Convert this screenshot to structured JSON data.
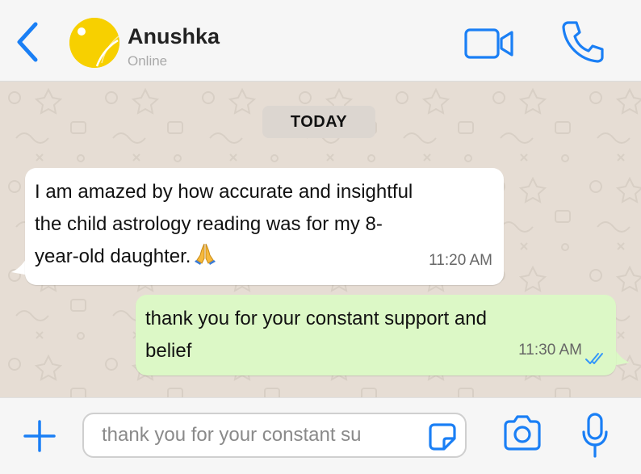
{
  "header": {
    "back_icon": "chevron-left-icon",
    "contact_name": "Anushka",
    "contact_status": "Online",
    "video_icon": "video-camera-icon",
    "call_icon": "phone-icon"
  },
  "chat": {
    "date_separator": "TODAY",
    "messages": [
      {
        "direction": "incoming",
        "lines": [
          "I am amazed by how accurate and insightful",
          "the child astrology reading was for my 8-",
          "year-old daughter."
        ],
        "emoji": "folded-hands-icon",
        "time": "11:20 AM"
      },
      {
        "direction": "outgoing",
        "lines": [
          "thank you for your constant support and",
          "belief"
        ],
        "time": "11:30 AM",
        "status_icon": "double-check-icon"
      }
    ]
  },
  "composer": {
    "plus_icon": "plus-icon",
    "input_value": "thank you for your constant su",
    "sticker_icon": "sticker-icon",
    "camera_icon": "camera-icon",
    "mic_icon": "microphone-icon"
  },
  "colors": {
    "accent": "#1a7ff5",
    "incoming_bubble": "#ffffff",
    "outgoing_bubble": "#dcf8c6",
    "chat_background": "#e6ddd4",
    "read_ticks": "#3497f9"
  }
}
